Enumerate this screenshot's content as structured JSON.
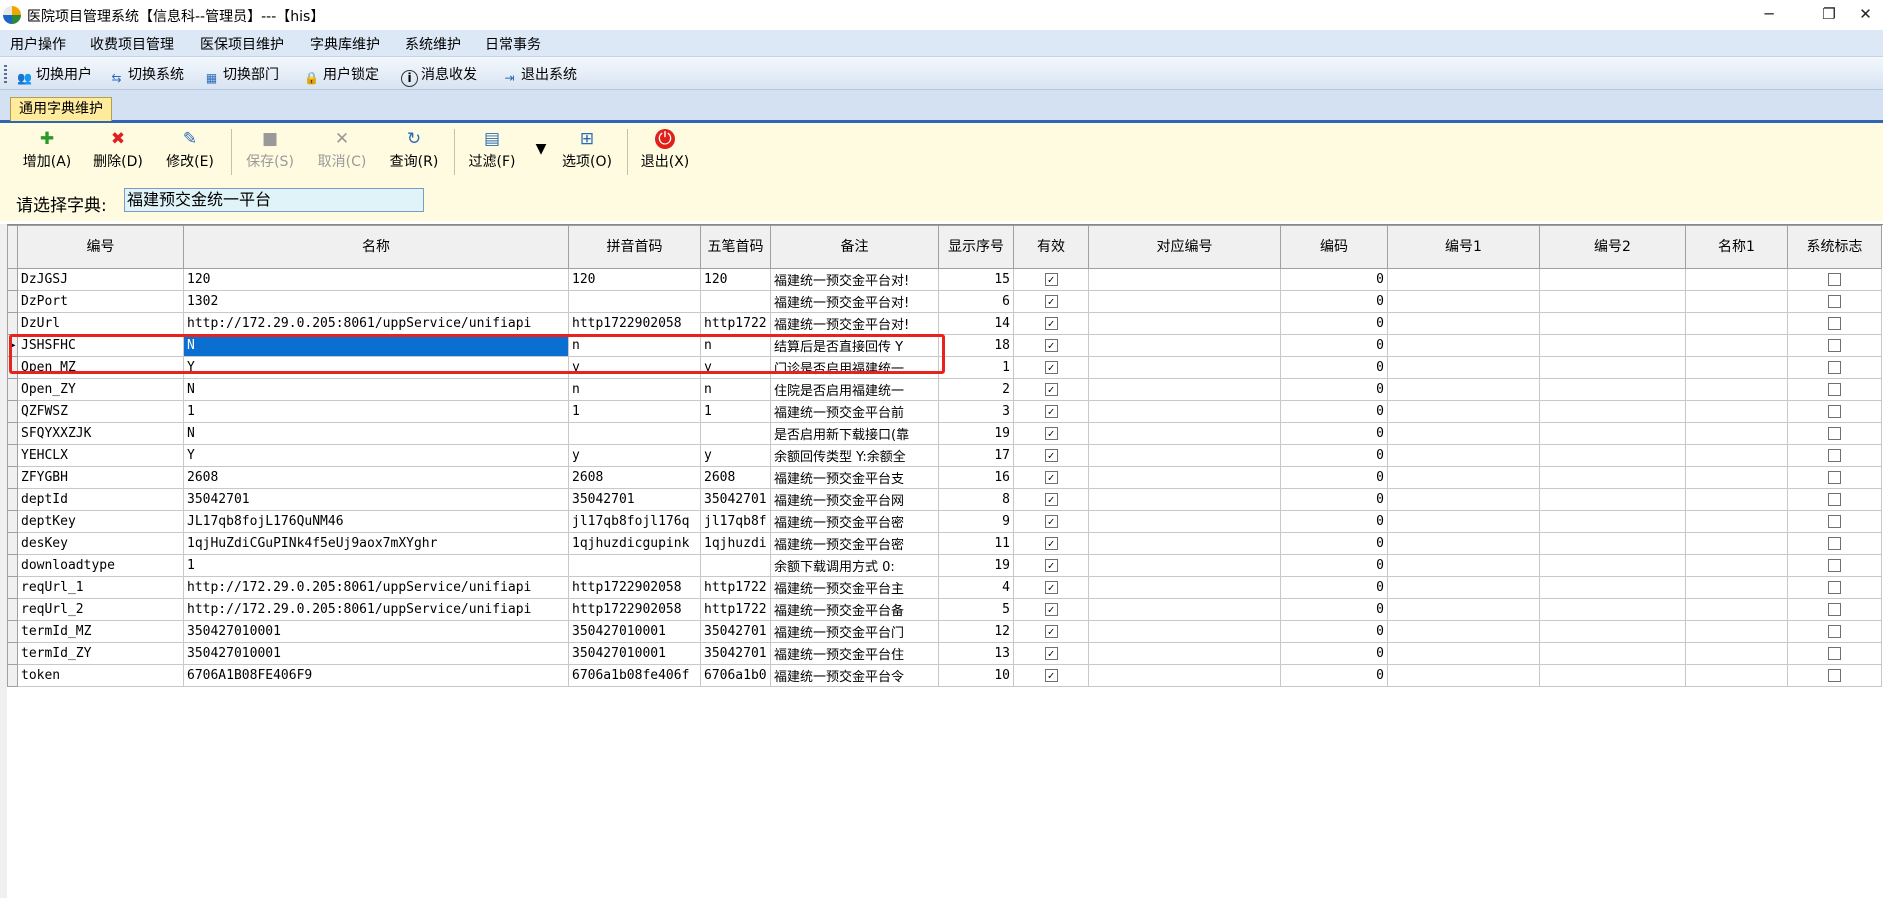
{
  "window": {
    "title": "医院项目管理系统【信息科--管理员】---【his】",
    "minimize": "─",
    "restore": "❐",
    "close": "✕"
  },
  "menu": [
    "用户操作",
    "收费项目管理",
    "医保项目维护",
    "字典库维护",
    "系统维护",
    "日常事务"
  ],
  "toolbar": [
    {
      "label": "切换用户",
      "icon": "users-icon"
    },
    {
      "label": "切换系统",
      "icon": "switch-system-icon"
    },
    {
      "label": "切换部门",
      "icon": "department-icon"
    },
    {
      "label": "用户锁定",
      "icon": "user-lock-icon"
    },
    {
      "label": "消息收发",
      "icon": "info-icon"
    },
    {
      "label": "退出系统",
      "icon": "exit-icon"
    }
  ],
  "tab": "通用字典维护",
  "ribbon": {
    "add": "增加(A)",
    "delete": "删除(D)",
    "modify": "修改(E)",
    "save": "保存(S)",
    "cancel": "取消(C)",
    "query": "查询(R)",
    "filter": "过滤(F)",
    "options": "选项(O)",
    "exit": "退出(X)"
  },
  "dict_select": {
    "label": "请选择字典:",
    "value": "福建预交金统一平台"
  },
  "grid": {
    "columns": [
      "编号",
      "名称",
      "拼音首码",
      "五笔首码",
      "备注",
      "显示序号",
      "有效",
      "对应编号",
      "编码",
      "编号1",
      "编号2",
      "名称1",
      "系统标志"
    ],
    "selected_row": 3,
    "rows": [
      {
        "code": "DzJGSJ",
        "name": "120",
        "py": "120",
        "wb": "120",
        "memo": "福建统一预交金平台对!",
        "seq": "15",
        "valid": true,
        "dy": "",
        "bm": "0",
        "n1": "",
        "n2": "",
        "mc1": "",
        "sys": false
      },
      {
        "code": "DzPort",
        "name": "1302",
        "py": "",
        "wb": "",
        "memo": "福建统一预交金平台对!",
        "seq": "6",
        "valid": true,
        "dy": "",
        "bm": "0",
        "n1": "",
        "n2": "",
        "mc1": "",
        "sys": false
      },
      {
        "code": "DzUrl",
        "name": "http://172.29.0.205:8061/uppService/unifiapi",
        "py": "http1722902058",
        "wb": "http1722",
        "memo": "福建统一预交金平台对!",
        "seq": "14",
        "valid": true,
        "dy": "",
        "bm": "0",
        "n1": "",
        "n2": "",
        "mc1": "",
        "sys": false
      },
      {
        "code": "JSHSFHC",
        "name": "N",
        "py": "n",
        "wb": "n",
        "memo": "结算后是否直接回传 Y",
        "seq": "18",
        "valid": true,
        "dy": "",
        "bm": "0",
        "n1": "",
        "n2": "",
        "mc1": "",
        "sys": false
      },
      {
        "code": "Open_MZ",
        "name": "Y",
        "py": "y",
        "wb": "y",
        "memo": "门诊是否启用福建统一",
        "seq": "1",
        "valid": true,
        "dy": "",
        "bm": "0",
        "n1": "",
        "n2": "",
        "mc1": "",
        "sys": false
      },
      {
        "code": "Open_ZY",
        "name": "N",
        "py": "n",
        "wb": "n",
        "memo": "住院是否启用福建统一",
        "seq": "2",
        "valid": true,
        "dy": "",
        "bm": "0",
        "n1": "",
        "n2": "",
        "mc1": "",
        "sys": false
      },
      {
        "code": "QZFWSZ",
        "name": "1",
        "py": "1",
        "wb": "1",
        "memo": "福建统一预交金平台前",
        "seq": "3",
        "valid": true,
        "dy": "",
        "bm": "0",
        "n1": "",
        "n2": "",
        "mc1": "",
        "sys": false
      },
      {
        "code": "SFQYXXZJK",
        "name": "N",
        "py": "",
        "wb": "",
        "memo": "是否启用新下载接口(靠",
        "seq": "19",
        "valid": true,
        "dy": "",
        "bm": "0",
        "n1": "",
        "n2": "",
        "mc1": "",
        "sys": false
      },
      {
        "code": "YEHCLX",
        "name": "Y",
        "py": "y",
        "wb": "y",
        "memo": "余额回传类型 Y:余额全",
        "seq": "17",
        "valid": true,
        "dy": "",
        "bm": "0",
        "n1": "",
        "n2": "",
        "mc1": "",
        "sys": false
      },
      {
        "code": "ZFYGBH",
        "name": "2608",
        "py": "2608",
        "wb": "2608",
        "memo": "福建统一预交金平台支",
        "seq": "16",
        "valid": true,
        "dy": "",
        "bm": "0",
        "n1": "",
        "n2": "",
        "mc1": "",
        "sys": false
      },
      {
        "code": "deptId",
        "name": "35042701",
        "py": "35042701",
        "wb": "35042701",
        "memo": "福建统一预交金平台网",
        "seq": "8",
        "valid": true,
        "dy": "",
        "bm": "0",
        "n1": "",
        "n2": "",
        "mc1": "",
        "sys": false
      },
      {
        "code": "deptKey",
        "name": "JL17qb8fojL176QuNM46",
        "py": "jl17qb8fojl176q",
        "wb": "jl17qb8f",
        "memo": "福建统一预交金平台密",
        "seq": "9",
        "valid": true,
        "dy": "",
        "bm": "0",
        "n1": "",
        "n2": "",
        "mc1": "",
        "sys": false
      },
      {
        "code": "desKey",
        "name": "1qjHuZdiCGuPINk4f5eUj9aox7mXYghr",
        "py": "1qjhuzdicgupink",
        "wb": "1qjhuzdi",
        "memo": "福建统一预交金平台密",
        "seq": "11",
        "valid": true,
        "dy": "",
        "bm": "0",
        "n1": "",
        "n2": "",
        "mc1": "",
        "sys": false
      },
      {
        "code": "downloadtype",
        "name": "1",
        "py": "",
        "wb": "",
        "memo": "余额下载调用方式 0:",
        "seq": "19",
        "valid": true,
        "dy": "",
        "bm": "0",
        "n1": "",
        "n2": "",
        "mc1": "",
        "sys": false
      },
      {
        "code": "reqUrl_1",
        "name": "http://172.29.0.205:8061/uppService/unifiapi",
        "py": "http1722902058",
        "wb": "http1722",
        "memo": "福建统一预交金平台主",
        "seq": "4",
        "valid": true,
        "dy": "",
        "bm": "0",
        "n1": "",
        "n2": "",
        "mc1": "",
        "sys": false
      },
      {
        "code": "reqUrl_2",
        "name": "http://172.29.0.205:8061/uppService/unifiapi",
        "py": "http1722902058",
        "wb": "http1722",
        "memo": "福建统一预交金平台备",
        "seq": "5",
        "valid": true,
        "dy": "",
        "bm": "0",
        "n1": "",
        "n2": "",
        "mc1": "",
        "sys": false
      },
      {
        "code": "termId_MZ",
        "name": "350427010001",
        "py": "350427010001",
        "wb": "35042701",
        "memo": "福建统一预交金平台门",
        "seq": "12",
        "valid": true,
        "dy": "",
        "bm": "0",
        "n1": "",
        "n2": "",
        "mc1": "",
        "sys": false
      },
      {
        "code": "termId_ZY",
        "name": "350427010001",
        "py": "350427010001",
        "wb": "35042701",
        "memo": "福建统一预交金平台住",
        "seq": "13",
        "valid": true,
        "dy": "",
        "bm": "0",
        "n1": "",
        "n2": "",
        "mc1": "",
        "sys": false
      },
      {
        "code": "token",
        "name": "6706A1B08FE406F9",
        "py": "6706a1b08fe406f",
        "wb": "6706a1b0",
        "memo": "福建统一预交金平台令",
        "seq": "10",
        "valid": true,
        "dy": "",
        "bm": "0",
        "n1": "",
        "n2": "",
        "mc1": "",
        "sys": false
      }
    ]
  }
}
